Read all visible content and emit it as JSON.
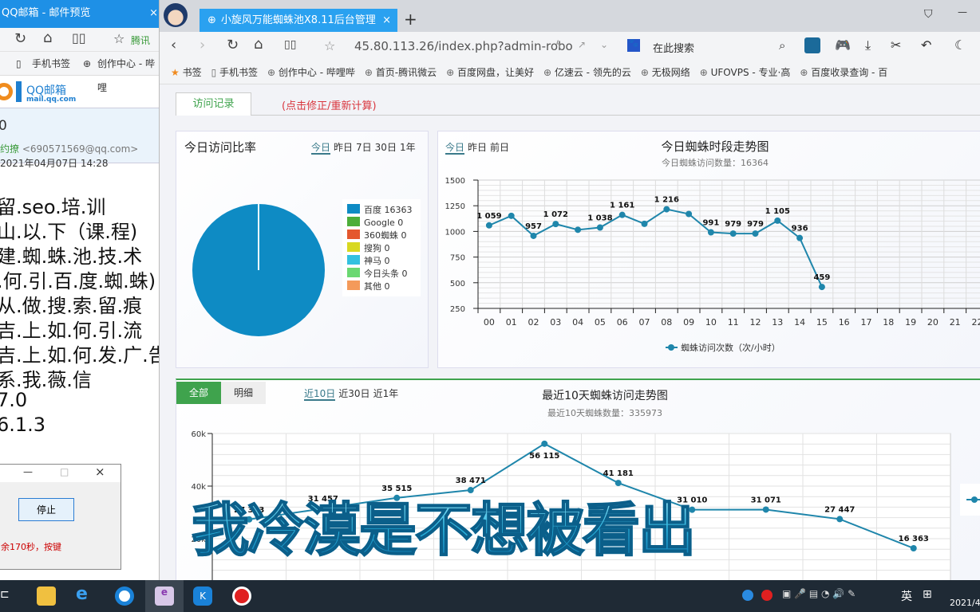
{
  "left_window": {
    "title": "QQ邮箱 - 邮件预览",
    "toolbar_bookmark": "腾讯",
    "bookmarks": [
      "手机书签",
      "创作中心 - 哔哩"
    ],
    "logo_text": "QQ邮箱",
    "logo_sub": "mail.qq.com",
    "subject": "0",
    "sender_name": "约撩",
    "sender_email": "<690571569@qq.com>",
    "date": "2021年04月07日 14:28",
    "body_lines": [
      "留.seo.培.训",
      "山.以.下（课.程)",
      "建.蜘.蛛.池.技.术",
      ".何.引.百.度.蜘.蛛)",
      "从.做.搜.索.留.痕",
      "吉.上.如.何.引.流",
      "吉.上.如.何.发.广.告",
      "系.我.薇.信",
      "7.0",
      "6.1.3"
    ],
    "dialog": {
      "stop_button": "停止",
      "message": "余170秒，按键"
    }
  },
  "browser": {
    "tab_title": "小旋风万能蜘蛛池X8.11后台管理",
    "url": "45.80.113.26/index.php?admin-robo",
    "search_placeholder": "在此搜索",
    "bookmarks": [
      "书签",
      "手机书签",
      "创作中心 - 哔哩哔",
      "首页-腾讯微云",
      "百度网盘，让美好",
      "亿速云 - 领先的云",
      "无极网络",
      "UFOVPS - 专业·高",
      "百度收录查询 - 百"
    ]
  },
  "page": {
    "tabs": [
      {
        "label": "访问记录",
        "active": true
      },
      {
        "label": "(点击修正/重新计算)",
        "color": "#d9363e"
      }
    ],
    "pie_panel": {
      "title": "今日访问比率",
      "ranges": [
        "今日",
        "昨日",
        "7日",
        "30日",
        "1年"
      ],
      "active_range": "今日"
    },
    "hour_panel": {
      "ranges": [
        "今日",
        "昨日",
        "前日"
      ],
      "active_range": "今日"
    },
    "bottom_panel": {
      "view_tabs": [
        "全部",
        "明细"
      ],
      "active_view": "全部",
      "ranges": [
        "近10日",
        "近30日",
        "近1年"
      ],
      "active_range": "近10日"
    },
    "accent_color": "#3fa34d"
  },
  "chart_data": [
    {
      "type": "pie",
      "title": "今日访问比率",
      "slices": [
        {
          "name": "百度",
          "value": 16363,
          "color": "#0e8bc4"
        },
        {
          "name": "Google",
          "value": 0,
          "color": "#4cae3a"
        },
        {
          "name": "360蜘蛛",
          "value": 0,
          "color": "#e4572e"
        },
        {
          "name": "搜狗",
          "value": 0,
          "color": "#d8d820"
        },
        {
          "name": "神马",
          "value": 0,
          "color": "#33c1e0"
        },
        {
          "name": "今日头条",
          "value": 0,
          "color": "#6ad872"
        },
        {
          "name": "其他",
          "value": 0,
          "color": "#f49a5a"
        }
      ],
      "legend_labels": [
        "百度 16363",
        "Google 0",
        "360蜘蛛 0",
        "搜狗 0",
        "神马 0",
        "今日头条 0",
        "其他 0"
      ],
      "legend": "right"
    },
    {
      "type": "line",
      "title": "今日蜘蛛时段走势图",
      "subtitle": "今日蜘蛛访问数量：16364",
      "categories": [
        "00",
        "01",
        "02",
        "03",
        "04",
        "05",
        "06",
        "07",
        "08",
        "09",
        "10",
        "11",
        "12",
        "13",
        "14",
        "15",
        "16",
        "17",
        "18",
        "19",
        "20",
        "21",
        "22"
      ],
      "series": [
        {
          "name": "蜘蛛访问次数（次/小时）",
          "values": [
            1059,
            1152,
            957,
            1072,
            1016,
            1038,
            1161,
            1074,
            1216,
            1170,
            991,
            979,
            979,
            1105,
            936,
            459
          ]
        }
      ],
      "data_labels": {
        "00": "1 059",
        "02": "957",
        "03": "1 072",
        "05": "1 038",
        "06": "1 161",
        "08": "1 216",
        "10": "991",
        "11": "979",
        "12": "979",
        "13": "1 105",
        "14": "936",
        "15": "459"
      },
      "yticks": [
        "1500",
        "1250",
        "1000",
        "750",
        "500",
        "250"
      ],
      "ylim": [
        250,
        1500
      ],
      "grid": true,
      "legend": "bottom",
      "color": "#1f86ab"
    },
    {
      "type": "line",
      "title": "最近10天蜘蛛访问走势图",
      "subtitle": "最近10天蜘蛛数量：335973",
      "values": [
        27343,
        31457,
        35515,
        38471,
        56115,
        41181,
        31010,
        31071,
        27447,
        16363
      ],
      "data_labels": [
        "27 343",
        "31 457",
        "35 515",
        "38 471",
        "56 115",
        "41 181",
        "31 010",
        "31 071",
        "27 447",
        "16 363"
      ],
      "yticks": [
        "60k",
        "40k",
        "20k"
      ],
      "ylim": [
        0,
        60000
      ],
      "grid": true,
      "legend": "right",
      "color": "#1f86ab"
    }
  ],
  "overlay_caption": "我冷漠是不想被看出",
  "taskbar": {
    "ime": "英",
    "clock_date": "2021/4"
  }
}
